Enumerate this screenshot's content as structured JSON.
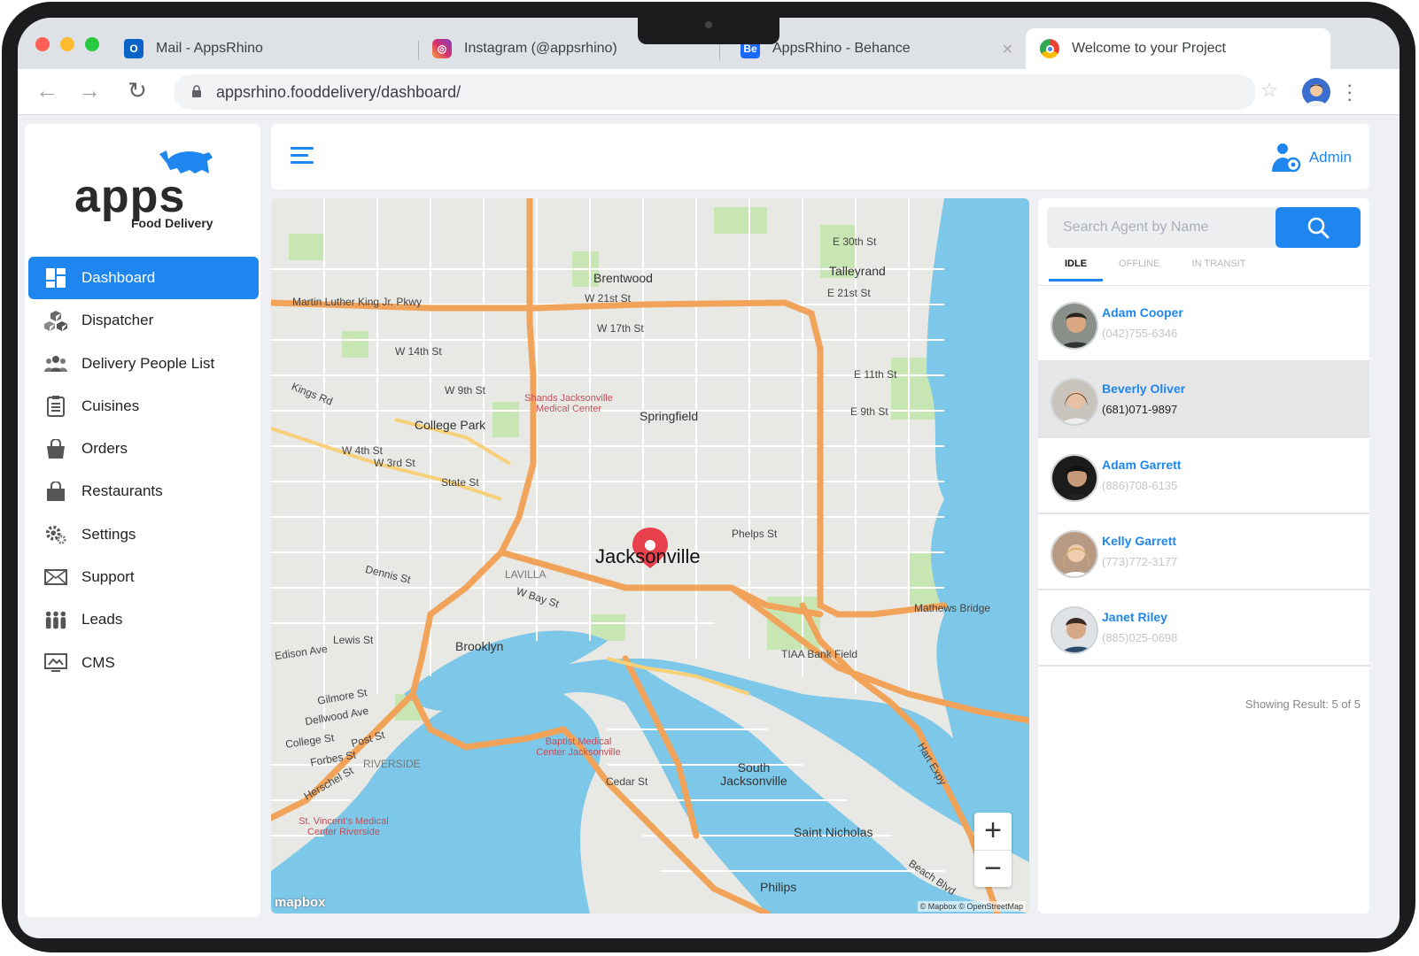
{
  "browser": {
    "tabs": [
      {
        "label": "Mail - AppsRhino",
        "icon": "outlook-icon",
        "color": "#0a64c8"
      },
      {
        "label": "Instagram (@appsrhino)",
        "icon": "instagram-icon",
        "color": "#d6306f"
      },
      {
        "label": "AppsRhino - Behance",
        "icon": "behance-icon",
        "color": "#1769ff"
      },
      {
        "label": "Welcome to your Project",
        "icon": "chrome-icon",
        "color": "#4285f4"
      }
    ],
    "url": "appsrhino.fooddelivery/dashboard/"
  },
  "brand": {
    "name": "apps",
    "subtitle": "Food Delivery",
    "accent": "#1f86ef"
  },
  "sidebar": {
    "items": [
      {
        "label": "Dashboard",
        "icon": "dashboard-icon",
        "active": true
      },
      {
        "label": "Dispatcher",
        "icon": "dispatcher-icon"
      },
      {
        "label": "Delivery People List",
        "icon": "people-icon"
      },
      {
        "label": "Cuisines",
        "icon": "cuisines-icon"
      },
      {
        "label": "Orders",
        "icon": "orders-icon"
      },
      {
        "label": "Restaurants",
        "icon": "restaurants-icon"
      },
      {
        "label": "Settings",
        "icon": "gear-icon"
      },
      {
        "label": "Support",
        "icon": "mail-icon"
      },
      {
        "label": "Leads",
        "icon": "leads-icon"
      },
      {
        "label": "CMS",
        "icon": "cms-icon"
      }
    ]
  },
  "header": {
    "user_label": "Admin"
  },
  "map": {
    "city": "Jacksonville",
    "labels": {
      "brentwood": "Brentwood",
      "talleyrand": "Talleyrand",
      "springfield": "Springfield",
      "college_park": "College Park",
      "lavilla": "LAVILLA",
      "brooklyn": "Brooklyn",
      "riverside": "RIVERSIDE",
      "south_jacksonville": "South Jacksonville",
      "saint_nicholas": "Saint Nicholas",
      "philips": "Philips",
      "shands": "Shands Jacksonville Medical Center",
      "baptist": "Baptist Medical Center Jacksonville",
      "st_vincents": "St. Vincent's Medical Center Riverside",
      "tiaa": "TIAA Bank Field",
      "mathews": "Mathews Bridge",
      "mlk": "Martin Luther King Jr. Pkwy",
      "kings_rd": "Kings Rd",
      "w21": "W 21st St",
      "w17": "W 17th St",
      "w14": "W 14th St",
      "w9": "W 9th St",
      "w4": "W 4th St",
      "w3": "W 3rd St",
      "state": "State St",
      "dennis": "Dennis St",
      "bay": "W Bay St",
      "lewis": "Lewis St",
      "edison": "Edison Ave",
      "gilmore": "Gilmore St",
      "dellwood": "Dellwood Ave",
      "college_st": "College St",
      "post_st": "Post St",
      "forbes": "Forbes St",
      "herschel": "Herschel St",
      "cedar": "Cedar St",
      "phelps": "Phelps St",
      "e30": "E 30th St",
      "e21": "E 21st St",
      "e11": "E 11th St",
      "e9": "E 9th St",
      "hart": "Hart Expy",
      "beach": "Beach Blvd"
    },
    "zoom_in": "+",
    "zoom_out": "−",
    "provider": "mapbox",
    "attribution": "© Mapbox © OpenStreetMap"
  },
  "agents_panel": {
    "search_placeholder": "Search Agent by Name",
    "tabs": [
      "IDLE",
      "OFFLINE",
      "IN TRANSIT"
    ],
    "active_tab": "IDLE",
    "agents": [
      {
        "name": "Adam Cooper",
        "phone": "(042)755-6346",
        "selected": false
      },
      {
        "name": "Beverly Oliver",
        "phone": "(681)071-9897",
        "selected": true
      },
      {
        "name": "Adam Garrett",
        "phone": "(886)708-6135",
        "selected": false
      },
      {
        "name": "Kelly Garrett",
        "phone": "(773)772-3177",
        "selected": false
      },
      {
        "name": "Janet Riley",
        "phone": "(885)025-0698",
        "selected": false
      }
    ],
    "showing": "Showing Result: 5 of 5"
  }
}
